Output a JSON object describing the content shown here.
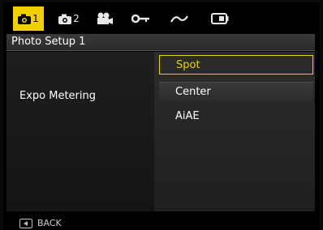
{
  "tabs": [
    {
      "icon": "camera-icon",
      "num": "1",
      "active": true
    },
    {
      "icon": "camera-icon",
      "num": "2",
      "active": false
    },
    {
      "icon": "video-camera-icon",
      "num": "",
      "active": false
    },
    {
      "icon": "wrench-icon",
      "num": "",
      "active": false
    },
    {
      "icon": "wave-icon",
      "num": "",
      "active": false
    },
    {
      "icon": "battery-icon",
      "num": "",
      "active": false
    }
  ],
  "header": {
    "title": "Photo Setup 1"
  },
  "setting": {
    "label": "Expo Metering"
  },
  "options": [
    {
      "label": "Spot",
      "selected": true
    },
    {
      "label": "Center",
      "selected": false
    },
    {
      "label": "AiAE",
      "selected": false
    }
  ],
  "footer": {
    "back_label": "BACK",
    "icon": "back-key-icon"
  },
  "colors": {
    "accent": "#f0d000",
    "background": "#000000"
  }
}
